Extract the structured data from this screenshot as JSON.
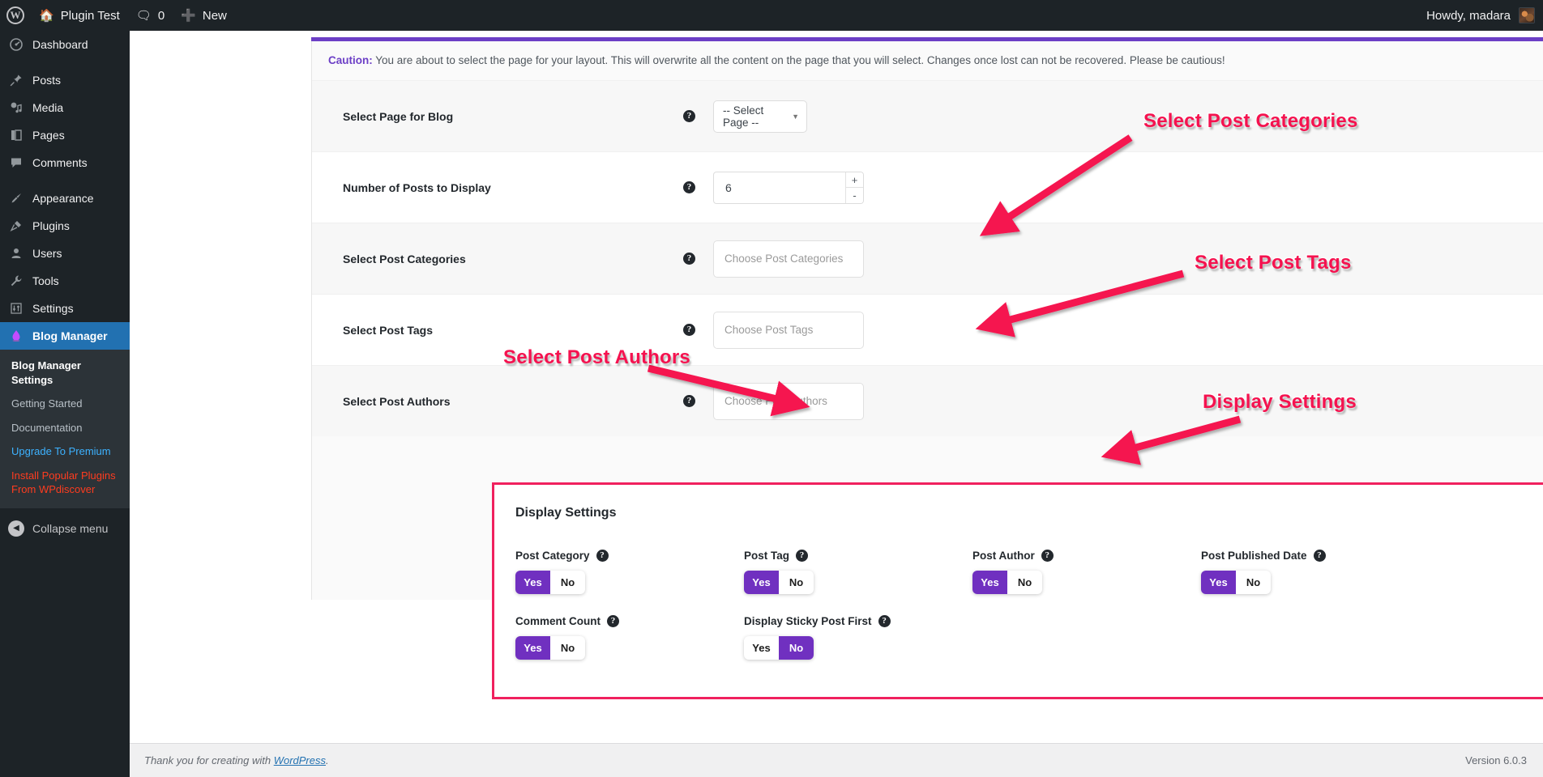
{
  "adminbar": {
    "logo_icon": "wordpress-logo-icon",
    "site_name": "Plugin Test",
    "home_icon": "home-icon",
    "comments_icon": "comment-bubble-icon",
    "comments_count": "0",
    "new_icon": "plus-icon",
    "new_label": "New",
    "howdy": "Howdy, madara",
    "avatar_icon": "user-avatar"
  },
  "sidebar": {
    "items": [
      {
        "label": "Dashboard",
        "icon": "dashboard-gauge-icon",
        "glyph": "◔"
      },
      {
        "label": "Posts",
        "icon": "pin-icon",
        "glyph": "✐"
      },
      {
        "label": "Media",
        "icon": "media-icon",
        "glyph": "♫"
      },
      {
        "label": "Pages",
        "icon": "pages-icon",
        "glyph": "▤"
      },
      {
        "label": "Comments",
        "icon": "comment-bubble-icon",
        "glyph": "▭"
      },
      {
        "label": "Appearance",
        "icon": "paintbrush-icon",
        "glyph": "✒"
      },
      {
        "label": "Plugins",
        "icon": "plug-icon",
        "glyph": "⚡"
      },
      {
        "label": "Users",
        "icon": "user-icon",
        "glyph": "●"
      },
      {
        "label": "Tools",
        "icon": "wrench-icon",
        "glyph": "⚒"
      },
      {
        "label": "Settings",
        "icon": "sliders-icon",
        "glyph": "⚙"
      },
      {
        "label": "Blog Manager",
        "icon": "blog-manager-flame-icon",
        "glyph": "▲",
        "current": true
      }
    ],
    "submenu": [
      {
        "label": "Blog Manager Settings",
        "state": "current"
      },
      {
        "label": "Getting Started",
        "state": "normal"
      },
      {
        "label": "Documentation",
        "state": "normal"
      },
      {
        "label": "Upgrade To Premium",
        "state": "upgrade"
      },
      {
        "label": "Install Popular Plugins From WPdiscover",
        "state": "promo"
      }
    ],
    "collapse_label": "Collapse menu",
    "collapse_icon": "chevron-left-circle-icon"
  },
  "notice": {
    "strong": "Caution:",
    "text": " You are about to select the page for your layout. This will overwrite all the content on the page that you will select. Changes once lost can not be recovered. Please be cautious!"
  },
  "form": {
    "rows": [
      {
        "label": "Select Page for Blog",
        "type": "select",
        "value": "-- Select Page --",
        "help_icon": "help-question-icon"
      },
      {
        "label": "Number of Posts to Display",
        "type": "number",
        "value": "6",
        "increment": "+",
        "decrement": "-",
        "help_icon": "help-question-icon"
      },
      {
        "label": "Select Post Categories",
        "type": "chooser",
        "placeholder": "Choose Post Categories",
        "help_icon": "help-question-icon"
      },
      {
        "label": "Select Post Tags",
        "type": "chooser",
        "placeholder": "Choose Post Tags",
        "help_icon": "help-question-icon"
      },
      {
        "label": "Select Post Authors",
        "type": "chooser",
        "placeholder": "Choose Post Authors",
        "help_icon": "help-question-icon"
      }
    ]
  },
  "display_settings": {
    "title": "Display Settings",
    "yes_label": "Yes",
    "no_label": "No",
    "toggles": [
      {
        "label": "Post Category",
        "value": "Yes",
        "help_icon": "help-question-icon"
      },
      {
        "label": "Post Tag",
        "value": "Yes",
        "help_icon": "help-question-icon"
      },
      {
        "label": "Post Author",
        "value": "Yes",
        "help_icon": "help-question-icon"
      },
      {
        "label": "Post Published Date",
        "value": "Yes",
        "help_icon": "help-question-icon"
      },
      {
        "label": "Comment Count",
        "value": "Yes",
        "help_icon": "help-question-icon"
      },
      {
        "label": "Display Sticky Post First",
        "value": "No",
        "help_icon": "help-question-icon"
      }
    ]
  },
  "annotations": [
    {
      "text": "Select Post Categories"
    },
    {
      "text": "Select Post Tags"
    },
    {
      "text": "Select Post Authors"
    },
    {
      "text": "Display Settings"
    }
  ],
  "footer": {
    "thanks_prefix": "Thank you for creating with ",
    "link": "WordPress",
    "thanks_suffix": ".",
    "version": "Version 6.0.3"
  },
  "colors": {
    "accent_purple": "#6c3fc6",
    "toggle_on": "#7030c0",
    "annotation_pink": "#f5124f",
    "admin_blue": "#2271b1",
    "sidebar_dark": "#1d2327"
  }
}
